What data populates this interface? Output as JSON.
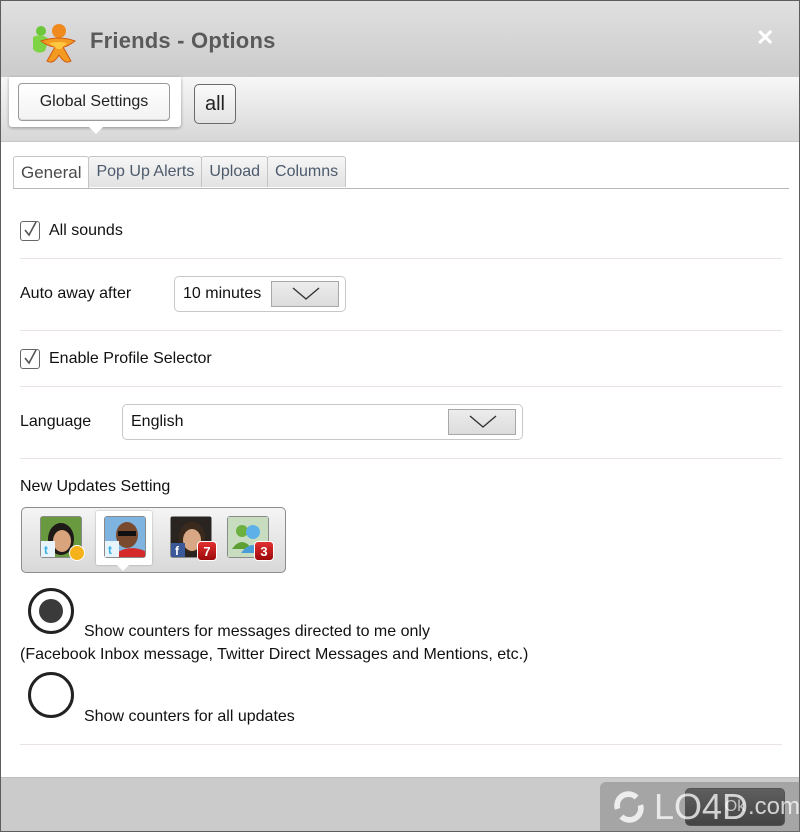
{
  "window": {
    "title": "Friends - Options",
    "close_icon": "close-x-icon"
  },
  "profilebar": {
    "global_settings_label": "Global Settings",
    "all_label": "all"
  },
  "tabs": [
    {
      "label": "General",
      "active": true
    },
    {
      "label": "Pop Up Alerts",
      "active": false
    },
    {
      "label": "Upload",
      "active": false
    },
    {
      "label": "Columns",
      "active": false
    }
  ],
  "general": {
    "all_sounds": {
      "label": "All sounds",
      "checked": true
    },
    "auto_away": {
      "label": "Auto away after",
      "value": "10 minutes"
    },
    "profile_selector": {
      "label": "Enable Profile Selector",
      "checked": true
    },
    "language": {
      "label": "Language",
      "value": "English"
    },
    "new_updates": {
      "label": "New Updates Setting",
      "accounts": [
        {
          "service": "twitter",
          "badge": "",
          "status": "away",
          "selected": false
        },
        {
          "service": "twitter",
          "badge": "",
          "status": "",
          "selected": true
        },
        {
          "service": "facebook",
          "badge": "7",
          "status": "",
          "selected": false
        },
        {
          "service": "messenger",
          "badge": "3",
          "status": "",
          "selected": false
        }
      ],
      "options": [
        {
          "label": "Show counters for messages directed to me only",
          "sublabel": "(Facebook Inbox message, Twitter Direct Messages and Mentions, etc.)",
          "selected": true
        },
        {
          "label": "Show counters for all updates",
          "selected": false
        }
      ]
    }
  },
  "footer": {
    "ok_label": "Ok"
  },
  "watermark": {
    "text": "LO4D",
    "suffix": ".com"
  },
  "colors": {
    "titlebar": "#d4d4d4",
    "tab_text": "#4c5a6c",
    "badge_red": "#c01818",
    "ok_button": "#2a2a2a"
  }
}
